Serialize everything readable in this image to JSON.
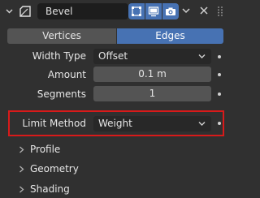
{
  "header": {
    "modifier_name": "Bevel",
    "icons": {
      "collapse": "chevron-down-icon",
      "modifier": "bevel-modifier-icon",
      "edit_mode": "edit-mode-icon",
      "viewport": "monitor-icon",
      "render": "camera-icon",
      "dropdown": "chevron-down-icon",
      "delete": "close-icon",
      "drag": "grip-icon"
    }
  },
  "tabs": [
    {
      "label": "Vertices",
      "active": false
    },
    {
      "label": "Edges",
      "active": true
    }
  ],
  "properties": {
    "width_type": {
      "label": "Width Type",
      "value": "Offset"
    },
    "amount": {
      "label": "Amount",
      "value": "0.1 m"
    },
    "segments": {
      "label": "Segments",
      "value": "1"
    },
    "limit_method": {
      "label": "Limit Method",
      "value": "Weight"
    }
  },
  "subpanels": [
    {
      "label": "Profile"
    },
    {
      "label": "Geometry"
    },
    {
      "label": "Shading"
    }
  ],
  "colors": {
    "accent": "#4772b3",
    "highlight": "#d81a1a",
    "background": "#303030"
  }
}
